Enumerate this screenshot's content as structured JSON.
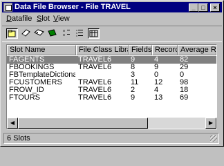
{
  "window": {
    "title": "Data File Browser - File TRAVEL"
  },
  "titlebar_buttons": {
    "minimize": "_",
    "maximize": "□",
    "close": "×"
  },
  "menu": [
    {
      "label": "Datafile",
      "underline": "D"
    },
    {
      "label": "Slot",
      "underline": "S"
    },
    {
      "label": "View",
      "underline": "V"
    }
  ],
  "toolbar": [
    "open-file-icon",
    "eraser-icon",
    "tag-icon",
    "book-icon",
    "small-icons-view-icon",
    "list-view-icon",
    "details-view-icon"
  ],
  "columns": [
    "Slot Name",
    "File Class Library",
    "Fields",
    "Records",
    "Average Record"
  ],
  "rows": [
    {
      "name": "FAGENTS",
      "library": "TRAVEL6",
      "fields": "9",
      "records": "4",
      "average": "82",
      "selected": true
    },
    {
      "name": "FBOOKINGS",
      "library": "TRAVEL6",
      "fields": "8",
      "records": "9",
      "average": "29"
    },
    {
      "name": "FBTemplateDictionary",
      "library": "",
      "fields": "3",
      "records": "0",
      "average": "0"
    },
    {
      "name": "FCUSTOMERS",
      "library": "TRAVEL6",
      "fields": "11",
      "records": "12",
      "average": "98"
    },
    {
      "name": "FROW_ID",
      "library": "TRAVEL6",
      "fields": "2",
      "records": "4",
      "average": "18"
    },
    {
      "name": "FTOURS",
      "library": "TRAVEL6",
      "fields": "9",
      "records": "13",
      "average": "69"
    }
  ],
  "scrollbar": {
    "left_arrow": "◀",
    "right_arrow": "▶"
  },
  "status": {
    "text": "6 Slots"
  },
  "colors": {
    "title_bg": "#000080",
    "selection": "#808080",
    "face": "#c0c0c0"
  }
}
